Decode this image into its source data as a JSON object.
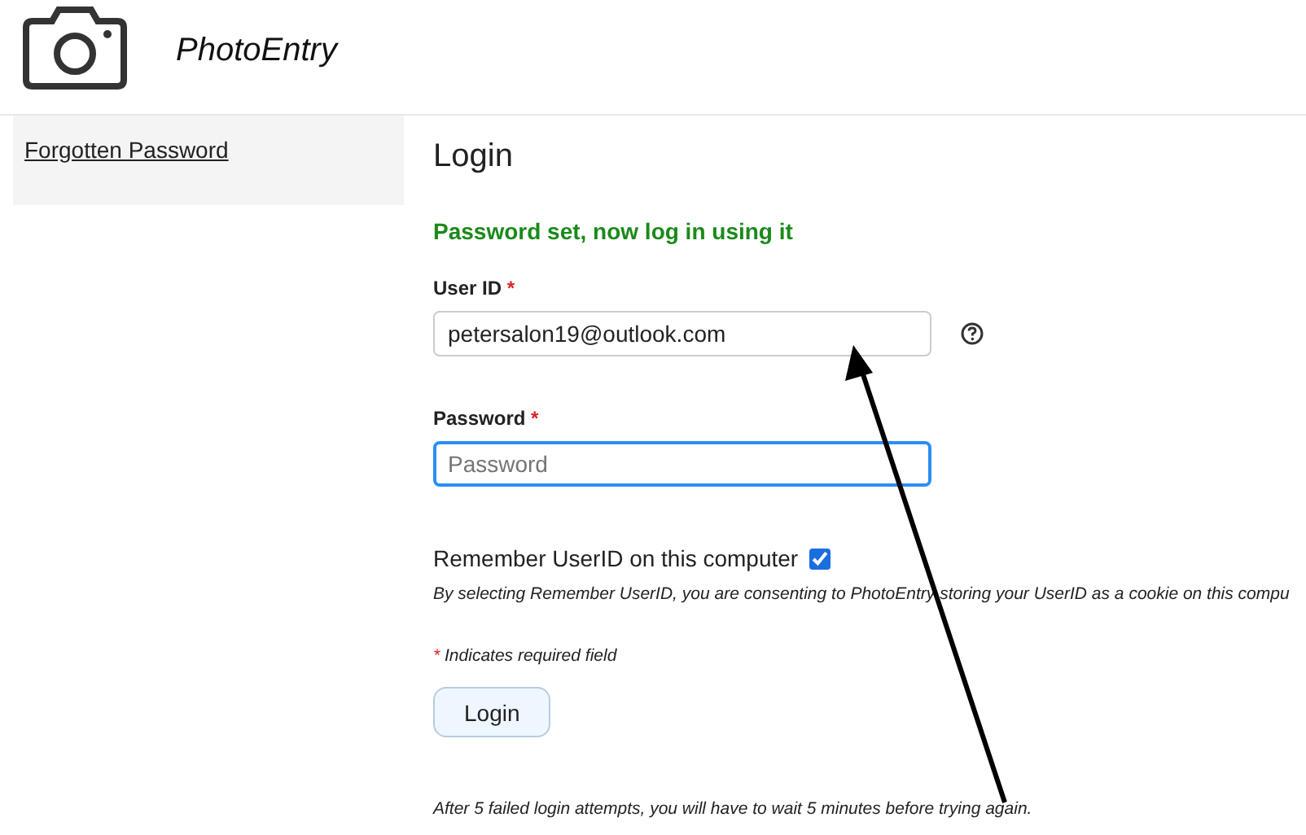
{
  "header": {
    "title": "PhotoEntry"
  },
  "sidebar": {
    "items": [
      {
        "label": "Forgotten Password"
      }
    ]
  },
  "main": {
    "heading": "Login",
    "message": "Password set, now log in using it",
    "fields": [
      {
        "label": "User ID",
        "required": true,
        "value": "petersalon19@outlook.com",
        "help": true,
        "focused": false
      },
      {
        "label": "Password",
        "required": true,
        "placeholder": "Password",
        "focused": true
      }
    ],
    "remember": {
      "label": "Remember UserID on this computer",
      "checked": true
    },
    "consent": "By selecting Remember UserID, you are consenting to PhotoEntry storing your UserID as a cookie on this compu",
    "required_note": {
      "mark": "*",
      "text": "Indicates required field"
    },
    "button": "Login",
    "footer": "After 5 failed login attempts, you will have to wait 5 minutes before trying again."
  }
}
